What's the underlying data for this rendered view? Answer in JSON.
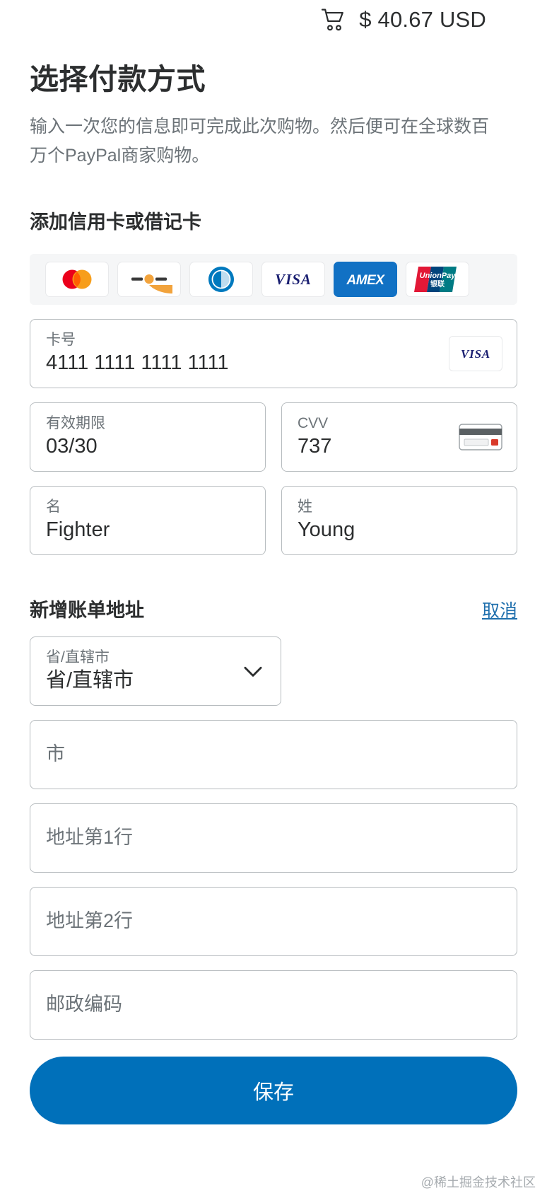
{
  "header": {
    "cart_icon": "shopping-cart-icon",
    "amount": "$ 40.67 USD"
  },
  "page": {
    "title": "选择付款方式",
    "subtitle": "输入一次您的信息即可完成此次购物。然后便可在全球数百万个PayPal商家购物。",
    "section_heading": "添加信用卡或借记卡"
  },
  "card_brands": [
    {
      "name": "mastercard-logo",
      "label": "Mastercard"
    },
    {
      "name": "discover-logo",
      "label": "Discover"
    },
    {
      "name": "diners-club-logo",
      "label": "Diners Club"
    },
    {
      "name": "visa-logo",
      "label": "VISA"
    },
    {
      "name": "amex-logo",
      "label": "AMEX"
    },
    {
      "name": "unionpay-logo",
      "label": "UnionPay"
    }
  ],
  "card_form": {
    "number": {
      "label": "卡号",
      "value": "4111 1111 1111 1111",
      "brand_icon": "visa-logo"
    },
    "expiry": {
      "label": "有效期限",
      "value": "03/30"
    },
    "cvv": {
      "label": "CVV",
      "value": "737",
      "icon": "cvv-card-icon"
    },
    "first_name": {
      "label": "名",
      "value": "Fighter"
    },
    "last_name": {
      "label": "姓",
      "value": "Young"
    }
  },
  "billing": {
    "heading": "新增账单地址",
    "cancel_label": "取消",
    "state": {
      "label": "省/直辖市",
      "value": "省/直辖市",
      "icon": "chevron-down-icon"
    },
    "city": {
      "placeholder": "市"
    },
    "address1": {
      "placeholder": "地址第1行"
    },
    "address2": {
      "placeholder": "地址第2行"
    },
    "postal": {
      "placeholder": "邮政编码"
    }
  },
  "actions": {
    "save_label": "保存"
  },
  "footer": {
    "watermark": "@稀土掘金技术社区"
  },
  "colors": {
    "brand_blue": "#0070ba",
    "link_blue": "#1f6fad",
    "text": "#2c2e2f",
    "muted": "#6c7378",
    "panel": "#f5f6f7",
    "border": "#b7bcbf"
  }
}
